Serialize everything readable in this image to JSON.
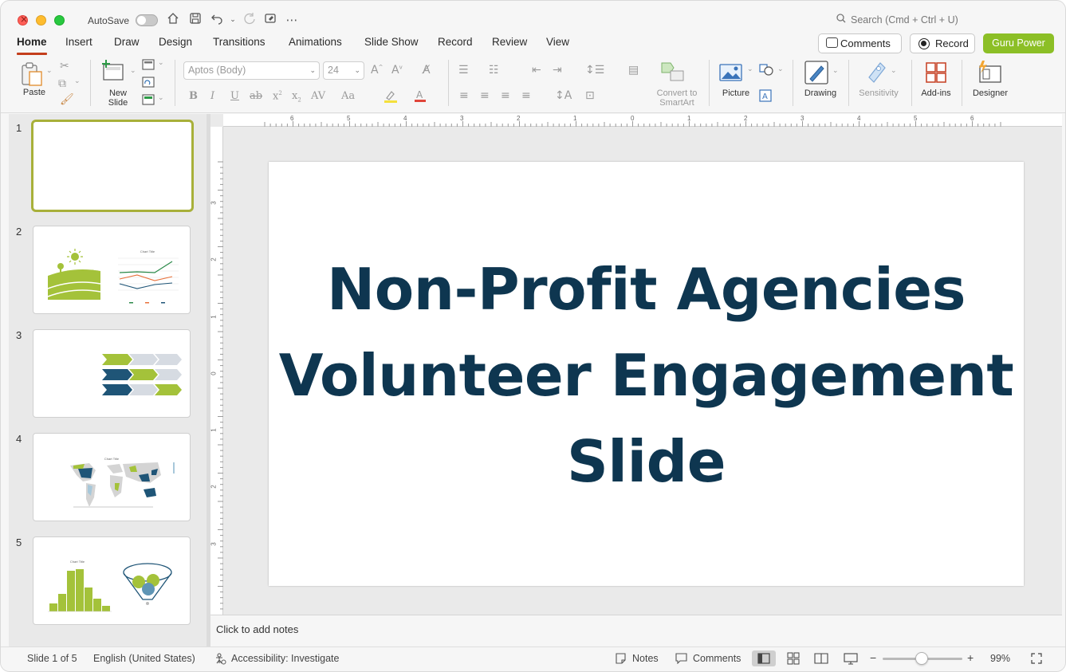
{
  "titlebar": {
    "autosave_label": "AutoSave",
    "autosave_on": false,
    "search_placeholder": "Search (Cmd + Ctrl + U)"
  },
  "menu": {
    "tabs": [
      "Home",
      "Insert",
      "Draw",
      "Design",
      "Transitions",
      "Animations",
      "Slide Show",
      "Record",
      "Review",
      "View"
    ],
    "active": "Home",
    "comments_label": "Comments",
    "record_label": "Record",
    "guru_label": "Guru Power"
  },
  "ribbon": {
    "paste_label": "Paste",
    "new_slide_label_1": "New",
    "new_slide_label_2": "Slide",
    "font_name": "Aptos (Body)",
    "font_size": "24",
    "convert_label_1": "Convert to",
    "convert_label_2": "SmartArt",
    "picture_label": "Picture",
    "drawing_label": "Drawing",
    "sensitivity_label": "Sensitivity",
    "addins_label": "Add-ins",
    "designer_label": "Designer"
  },
  "thumbnails": [
    {
      "number": "1",
      "selected": true
    },
    {
      "number": "2",
      "selected": false,
      "chart_title": "Chart Title"
    },
    {
      "number": "3",
      "selected": false
    },
    {
      "number": "4",
      "selected": false,
      "chart_title": "Chart Title"
    },
    {
      "number": "5",
      "selected": false,
      "chart_title": "Chart Title"
    }
  ],
  "ruler": {
    "horizontal": [
      "6",
      "5",
      "4",
      "3",
      "2",
      "1",
      "0",
      "1",
      "2",
      "3",
      "4",
      "5",
      "6"
    ],
    "vertical": [
      "3",
      "2",
      "1",
      "0",
      "1",
      "2",
      "3"
    ]
  },
  "slide": {
    "title_line1": "Non-Profit Agencies",
    "title_line2": "Volunteer Engagement",
    "title_line3": "Slide",
    "title_color": "#0e3650"
  },
  "notes": {
    "placeholder": "Click to add notes"
  },
  "status": {
    "slide_counter": "Slide 1 of 5",
    "language": "English (United States)",
    "accessibility": "Accessibility: Investigate",
    "notes_label": "Notes",
    "comments_label": "Comments",
    "zoom": "99%",
    "zoom_minus": "−",
    "zoom_plus": "+"
  },
  "colors": {
    "accent_green": "#8cbf26",
    "slide_green": "#a4c23a",
    "slide_navy": "#1f5577",
    "tab_underline": "#c43e1c"
  }
}
